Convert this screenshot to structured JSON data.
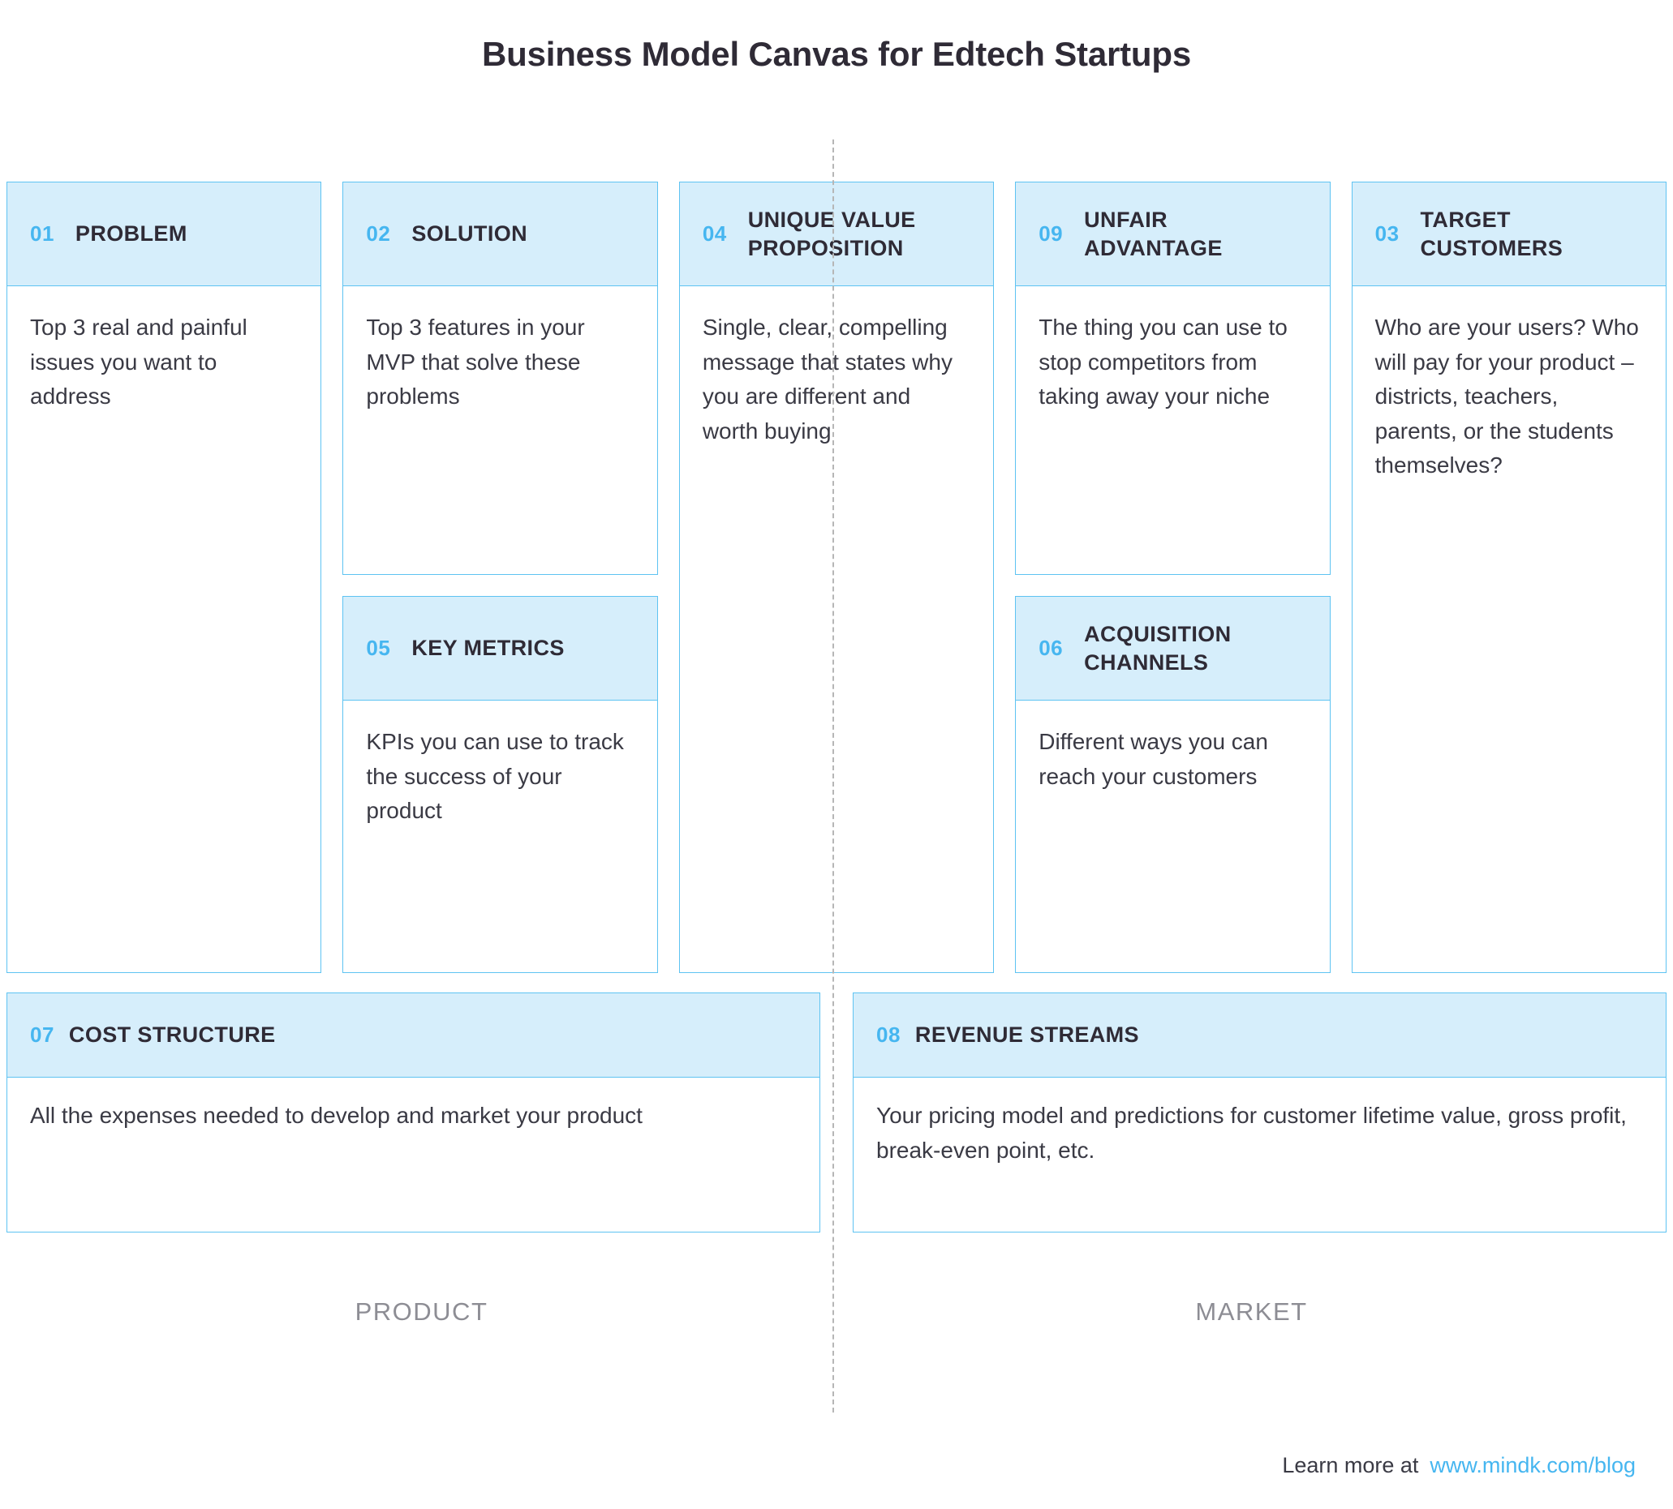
{
  "title": "Business Model Canvas for Edtech Startups",
  "accent_color": "#46b6f0",
  "header_bg_color": "#d6eefb",
  "border_color": "#5ec3f2",
  "columns": [
    {
      "cards": [
        {
          "num": "01",
          "title": "PROBLEM",
          "body": "Top 3 real and painful issues you want to address"
        }
      ]
    },
    {
      "cards": [
        {
          "num": "02",
          "title": "SOLUTION",
          "body": "Top 3 features in your MVP that solve these problems"
        },
        {
          "num": "05",
          "title": "KEY METRICS",
          "body": "KPIs you can use to track the success of your product"
        }
      ]
    },
    {
      "cards": [
        {
          "num": "04",
          "title": "UNIQUE VALUE PROPOSITION",
          "body": "Single, clear, compelling message that states why you are different and worth buying"
        }
      ]
    },
    {
      "cards": [
        {
          "num": "09",
          "title": "UNFAIR ADVANTAGE",
          "body": "The thing you can use to stop competitors from taking away your niche"
        },
        {
          "num": "06",
          "title": "ACQUISITION CHANNELS",
          "body": "Different ways you can reach your customers"
        }
      ]
    },
    {
      "cards": [
        {
          "num": "03",
          "title": "TARGET CUSTOMERS",
          "body": "Who are your users? Who will pay for your product – districts, teachers, parents, or the students themselves?"
        }
      ]
    }
  ],
  "bottom": [
    {
      "num": "07",
      "title": "COST STRUCTURE",
      "body": "All the expenses needed to develop and market your product"
    },
    {
      "num": "08",
      "title": "REVENUE STREAMS",
      "body": "Your pricing model and predictions for customer lifetime value, gross profit, break-even point, etc."
    }
  ],
  "section_labels": [
    "PRODUCT",
    "MARKET"
  ],
  "footer": {
    "prefix": "Learn more at",
    "link": "www.mindk.com/blog"
  }
}
